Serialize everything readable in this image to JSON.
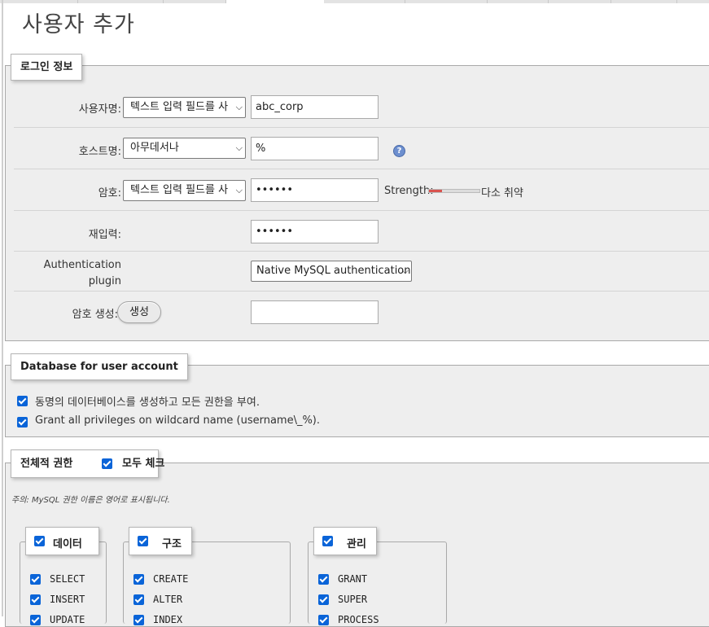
{
  "page": {
    "title": "사용자 추가"
  },
  "login": {
    "legend": "로그인 정보",
    "username": {
      "label": "사용자명:",
      "mode": "텍스트 입력 필드를 사",
      "value": "abc_corp"
    },
    "host": {
      "label": "호스트명:",
      "mode": "아무데서나",
      "value": "%"
    },
    "password": {
      "label": "암호:",
      "mode": "텍스트 입력 필드를 사",
      "value": "••••••",
      "strength_label": "Strength:",
      "strength_text": "다소 취약",
      "strength_level": 0.25
    },
    "reenter": {
      "label": "재입력:",
      "value": "••••••"
    },
    "auth": {
      "label_line1": "Authentication",
      "label_line2": "plugin",
      "value": "Native MySQL authentication"
    },
    "generate": {
      "label": "암호 생성:",
      "button": "생성",
      "value": ""
    }
  },
  "database": {
    "legend": "Database for user account",
    "options": [
      {
        "label": "동명의 데이터베이스를 생성하고 모든 권한을 부여.",
        "checked": true
      },
      {
        "label": "Grant all privileges on wildcard name (username\\_%).",
        "checked": true
      }
    ]
  },
  "global": {
    "legend": "전체적 권한",
    "check_all": "모두 체크",
    "note": "주의: MySQL 권한 이름은 영어로 표시됩니다.",
    "groups": [
      {
        "name": "데이터",
        "items": [
          "SELECT",
          "INSERT",
          "UPDATE"
        ]
      },
      {
        "name": "구조",
        "items": [
          "CREATE",
          "ALTER",
          "INDEX"
        ]
      },
      {
        "name": "관리",
        "items": [
          "GRANT",
          "SUPER",
          "PROCESS"
        ]
      }
    ]
  },
  "colors": {
    "checkbox": "#0a64d8",
    "fieldset_bg": "#eeeeee",
    "strength_bar": "#d9534f"
  }
}
